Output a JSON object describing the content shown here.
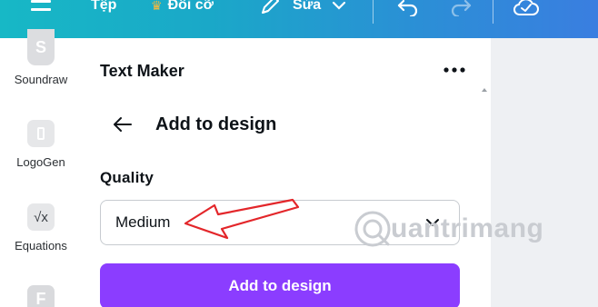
{
  "toolbar": {
    "file_label": "Tệp",
    "resize_label": "Đổi cỡ",
    "edit_label": "Sửa",
    "colors": {
      "gradient_start": "#17b8c6",
      "gradient_end": "#3a7ee0"
    }
  },
  "rail": {
    "items": [
      {
        "label": "Soundraw",
        "icon": "soundraw-app-icon"
      },
      {
        "label": "LogoGen",
        "icon": "logogen-app-icon"
      },
      {
        "label": "Equations",
        "icon": "equations-app-icon"
      },
      {
        "label": "",
        "icon": "f-app-icon"
      }
    ]
  },
  "panel": {
    "title": "Text Maker",
    "subheader": "Add to design",
    "quality_label": "Quality",
    "quality_value": "Medium",
    "primary_button": "Add to design"
  },
  "watermark": {
    "text": "uantrimang"
  },
  "colors": {
    "accent": "#8b3dff",
    "annotation_arrow": "#e3262a"
  }
}
